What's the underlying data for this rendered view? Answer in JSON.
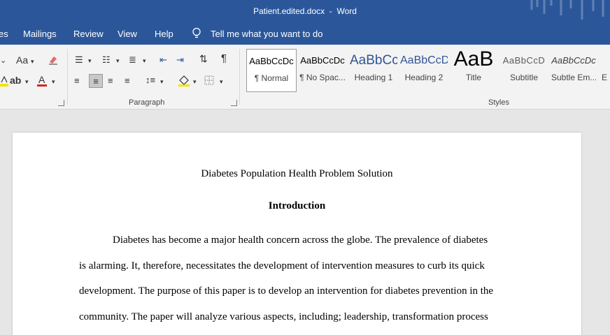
{
  "window": {
    "title": "Patient.edited.docx  -  Word"
  },
  "menu": {
    "items": [
      "es",
      "Mailings",
      "Review",
      "View",
      "Help"
    ],
    "tell_me": "Tell me what you want to do"
  },
  "ribbon": {
    "font_group": {
      "aa_label": "Aa"
    },
    "paragraph_group": {
      "label": "Paragraph"
    },
    "styles_group": {
      "label": "Styles",
      "tiles": [
        {
          "sample": "AaBbCcDc",
          "name": "¶ Normal"
        },
        {
          "sample": "AaBbCcDc",
          "name": "¶ No Spac..."
        },
        {
          "sample": "AaBbCc",
          "name": "Heading 1"
        },
        {
          "sample": "AaBbCcD",
          "name": "Heading 2"
        },
        {
          "sample": "AaB",
          "name": "Title"
        },
        {
          "sample": "AaBbCcD",
          "name": "Subtitle"
        },
        {
          "sample": "AaBbCcDc",
          "name": "Subtle Em..."
        },
        {
          "sample": "",
          "name": "E"
        }
      ]
    }
  },
  "document": {
    "title": "Diabetes Population Health Problem Solution",
    "heading": "Introduction",
    "lines": [
      "Diabetes has become a major health concern across the globe. The prevalence of diabetes",
      "is alarming. It, therefore, necessitates the development of intervention measures to curb its quick",
      "development. The purpose of this paper is to develop an intervention for diabetes prevention in the",
      "community. The paper will analyze various aspects, including; leadership, transformation process"
    ]
  },
  "colors": {
    "word_blue": "#2b579a",
    "ribbon_bg": "#f3f3f3",
    "canvas": "#e6e6e6"
  }
}
